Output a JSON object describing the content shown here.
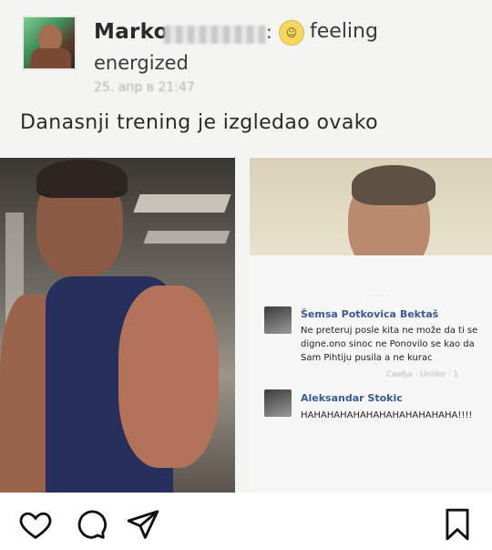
{
  "post": {
    "author_name": "Marko",
    "feeling_emoji": "grinning-face-icon",
    "feeling_label": "feeling",
    "feeling_value": "energized",
    "timestamp": "25. апр в 21:47",
    "colon": ":",
    "text": "Danasnji trening je izgledao ovako"
  },
  "comments": [
    {
      "author": "Šemsa Potkovica Bektaš",
      "text": "Ne preteruj posle kita ne može da ti se digne.ono sinoc ne Ponovilo se kao da Sam Pihtiju pusila a ne kurac",
      "meta": "Свиђа · Unlike · 1"
    },
    {
      "author": "Aleksandar Stokic",
      "text": "HAHAHAHAHAHAHAHAHAHAHAHA!!!!",
      "meta": ""
    }
  ],
  "actions": [
    "like",
    "comment",
    "share",
    "save"
  ],
  "colors": {
    "name_blue": "#3b5998",
    "icon_stroke": "#111111",
    "background": "#f4f4f2"
  }
}
